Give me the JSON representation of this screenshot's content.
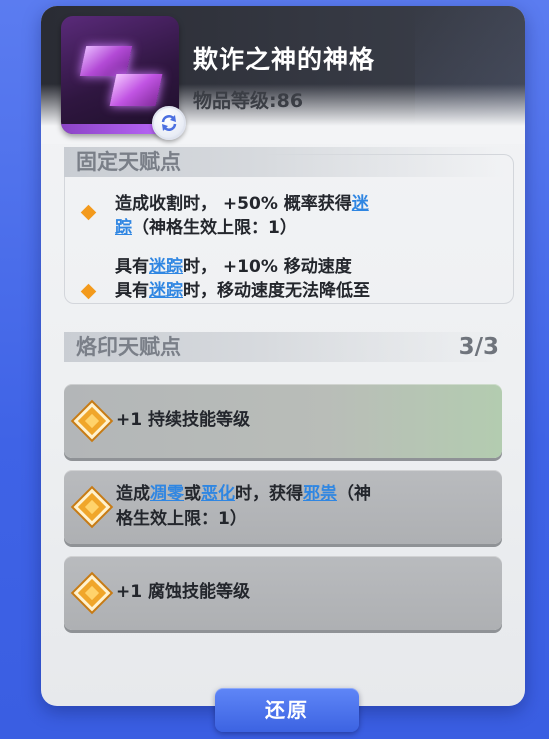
{
  "item": {
    "title": "欺诈之神的神格",
    "level_label": "物品等级:86",
    "icon_name": "divinity-shard-icon"
  },
  "fixed_talents": {
    "heading": "固定天赋点",
    "entries": [
      {
        "lines": [
          {
            "segments": [
              {
                "text": "造成收割时， +50% 概率获得"
              },
              {
                "text": "迷",
                "keyword": true
              }
            ]
          },
          {
            "segments": [
              {
                "text": "踪",
                "keyword": true
              },
              {
                "text": "（神格生效上限：1）"
              }
            ]
          }
        ]
      },
      {
        "lines": [
          {
            "segments": [
              {
                "text": "具有"
              },
              {
                "text": "迷踪",
                "keyword": true
              },
              {
                "text": "时， +10% 移动速度"
              }
            ]
          },
          {
            "segments": [
              {
                "text": "具有"
              },
              {
                "text": "迷踪",
                "keyword": true
              },
              {
                "text": "时，移动速度无法降低至"
              }
            ]
          }
        ]
      }
    ]
  },
  "branded_talents": {
    "heading": "烙印天赋点",
    "count": "3/3",
    "cards": [
      {
        "lines": [
          {
            "segments": [
              {
                "text": "+1 持续技能等级"
              }
            ]
          }
        ]
      },
      {
        "lines": [
          {
            "segments": [
              {
                "text": "造成"
              },
              {
                "text": "凋零",
                "keyword": true
              },
              {
                "text": "或"
              },
              {
                "text": "恶化",
                "keyword": true
              },
              {
                "text": "时，获得"
              },
              {
                "text": "邪祟",
                "keyword": true
              },
              {
                "text": "（神"
              }
            ]
          },
          {
            "segments": [
              {
                "text": "格生效上限：1）"
              }
            ]
          }
        ]
      },
      {
        "lines": [
          {
            "segments": [
              {
                "text": "+1 腐蚀技能等级"
              }
            ]
          }
        ]
      }
    ]
  },
  "actions": {
    "reset_label": "还原"
  },
  "colors": {
    "background": "#4a6cea",
    "keyword": "#2f86e2",
    "bullet": "#f39a1c"
  }
}
